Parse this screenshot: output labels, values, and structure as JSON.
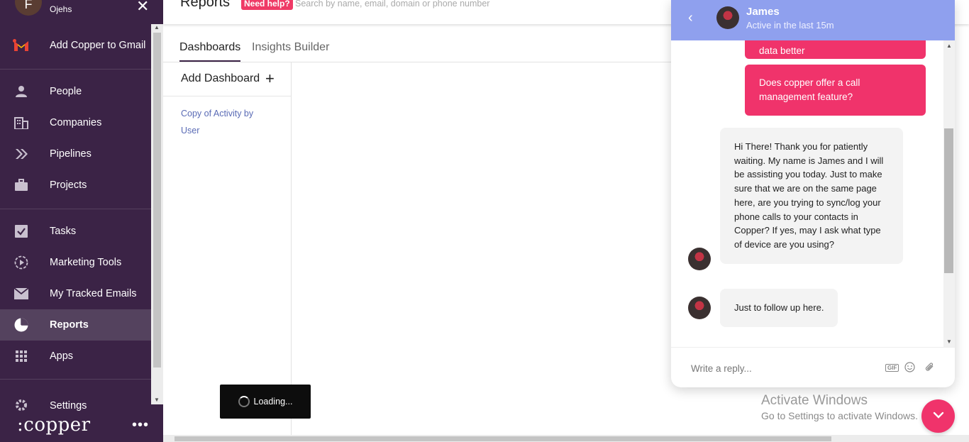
{
  "sidebar": {
    "user_initial": "F",
    "user_name": "Ojehs",
    "gmail_promo": "Add Copper to Gmail",
    "items": [
      {
        "label": "People",
        "icon": "person-icon"
      },
      {
        "label": "Companies",
        "icon": "building-icon"
      },
      {
        "label": "Pipelines",
        "icon": "pipeline-chevrons-icon"
      },
      {
        "label": "Projects",
        "icon": "briefcase-icon"
      },
      {
        "label": "Tasks",
        "icon": "checkbox-icon"
      },
      {
        "label": "Marketing Tools",
        "icon": "play-circle-icon"
      },
      {
        "label": "My Tracked Emails",
        "icon": "envelope-icon"
      },
      {
        "label": "Reports",
        "icon": "pie-chart-icon",
        "active": true
      },
      {
        "label": "Apps",
        "icon": "grid-icon"
      },
      {
        "label": "Settings",
        "icon": "gear-icon"
      }
    ],
    "logo": ":copper",
    "more": "•••"
  },
  "topbar": {
    "title": "Reports",
    "need_help": "Need help?",
    "search_placeholder": "Search by name, email, domain or phone number"
  },
  "tabs": {
    "dashboards": "Dashboards",
    "insights": "Insights Builder"
  },
  "dashboards": {
    "add_label": "Add Dashboard",
    "add_icon": "+",
    "items": [
      "Copy of Activity by User"
    ]
  },
  "loading": "Loading...",
  "watermark": {
    "line1": "Activate Windows",
    "line2": "Go to Settings to activate Windows."
  },
  "chat": {
    "agent_name": "James",
    "agent_status": "Active in the last 15m",
    "partial_message": "data better",
    "user_message": "Does copper offer a call management feature?",
    "agent_message_1": "Hi There! Thank you for patiently waiting. My name is James and I will be assisting you today. Just to make sure that we are on the same page here, are you trying to sync/log your phone calls to your contacts in Copper? If yes, may I ask what type of device are you using?",
    "agent_message_2": "Just to follow up here.",
    "reply_placeholder": "Write a reply...",
    "gif_label": "GIF"
  },
  "colors": {
    "sidebar_bg": "#3b2346",
    "accent_pink": "#f0336b",
    "chat_header": "#8fa0ee",
    "link": "#5a6bb5"
  }
}
